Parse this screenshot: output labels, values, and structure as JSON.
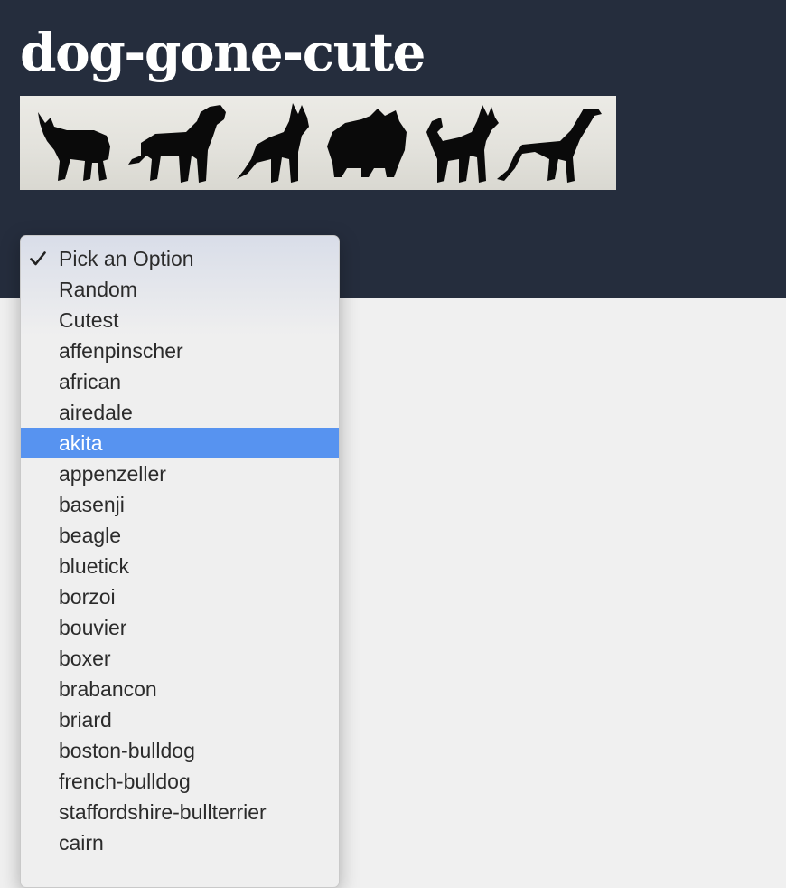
{
  "site": {
    "title": "dog-gone-cute"
  },
  "banner": {
    "image_name": "dog-silhouettes-banner",
    "icons": [
      "french-bulldog-silhouette-icon",
      "retriever-silhouette-icon",
      "shepherd-silhouette-icon",
      "pomeranian-silhouette-icon",
      "shiba-silhouette-icon",
      "greyhound-silhouette-icon"
    ]
  },
  "breed_select": {
    "selected": "Pick an Option",
    "highlighted": "akita",
    "options": [
      "Pick an Option",
      "Random",
      "Cutest",
      "affenpinscher",
      "african",
      "airedale",
      "akita",
      "appenzeller",
      "basenji",
      "beagle",
      "bluetick",
      "borzoi",
      "bouvier",
      "boxer",
      "brabancon",
      "briard",
      "boston-bulldog",
      "french-bulldog",
      "staffordshire-bullterrier",
      "cairn"
    ]
  },
  "colors": {
    "header_bg": "#252d3d",
    "page_bg": "#f0f0f0",
    "highlight": "#5793f0",
    "title": "#ffffff"
  }
}
